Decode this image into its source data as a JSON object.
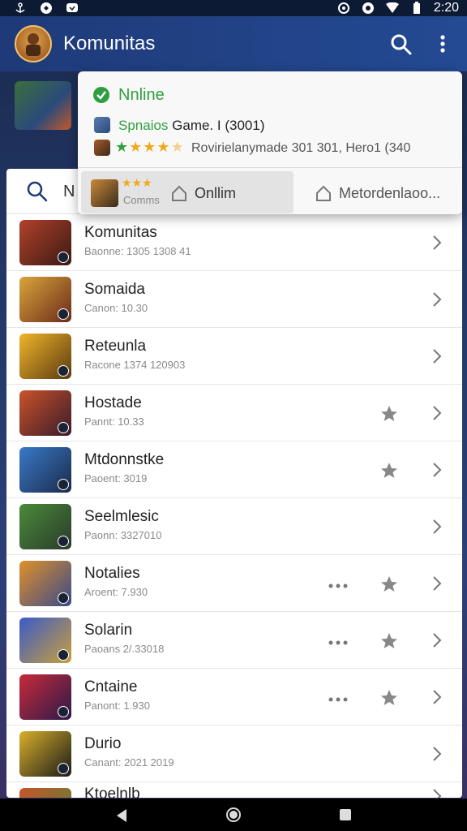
{
  "status_bar": {
    "time": "2:20"
  },
  "app_bar": {
    "title": "Komunitas"
  },
  "search": {
    "placeholder_text": "N"
  },
  "popup": {
    "status": "Nnline",
    "line1_accent": "Spnaios",
    "line1_rest": "Game. I (3001)",
    "line2": "Rovirielanymade 301 301, Hero1 (340",
    "tab_a_sub": "Comms",
    "tab_a_label": "Onllim",
    "tab_b_label": "Metordenlaoo..."
  },
  "list": [
    {
      "name": "Komunitas",
      "subtitle": "Baonne: 1305 1308 41",
      "star": false,
      "dots": false
    },
    {
      "name": "Somaida",
      "subtitle": "Canon: 10.30",
      "star": false,
      "dots": false
    },
    {
      "name": "Reteunla",
      "subtitle": "Racone 1374 120903",
      "star": false,
      "dots": false
    },
    {
      "name": "Hostade",
      "subtitle": "Pannt: 10.33",
      "star": true,
      "dots": false
    },
    {
      "name": "Mtdonnstke",
      "subtitle": "Paoent: 3019",
      "star": true,
      "dots": false
    },
    {
      "name": "Seelmlesic",
      "subtitle": "Paonn: 3327010",
      "star": false,
      "dots": false
    },
    {
      "name": "Notalies",
      "subtitle": "Aroent: 7.930",
      "star": true,
      "dots": true
    },
    {
      "name": "Solarin",
      "subtitle": "Paoans 2/.33018",
      "star": true,
      "dots": true
    },
    {
      "name": "Cntaine",
      "subtitle": "Panont: 1.930",
      "star": true,
      "dots": true
    },
    {
      "name": "Durio",
      "subtitle": "Canant: 2021 2019",
      "star": false,
      "dots": false
    },
    {
      "name": "Ktoelnlb",
      "subtitle": "",
      "star": false,
      "dots": false
    }
  ],
  "colors": {
    "accent_green": "#2f9e3f",
    "app_bar": "#1e3a78",
    "star_gold": "#f2a81d"
  }
}
